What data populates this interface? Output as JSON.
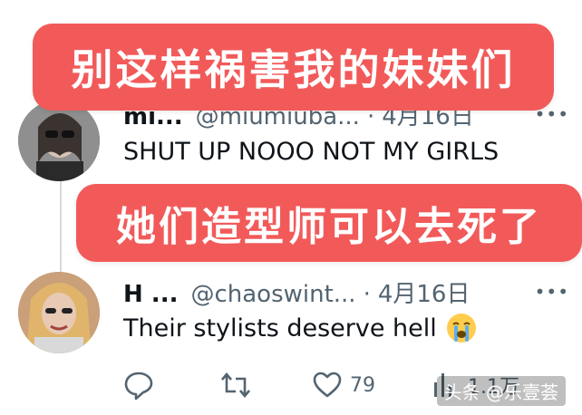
{
  "overlays": {
    "banner_1": "别这样祸害我的妹妹们",
    "banner_2": "她们造型师可以去死了"
  },
  "posts": [
    {
      "name": "mi...",
      "handle": "@miumiuba...",
      "separator": "·",
      "date": "4月16日",
      "more": "•••",
      "text": "SHUT UP NOOO NOT MY GIRLS"
    },
    {
      "name": "H ...",
      "handle": "@chaoswint...",
      "separator": "·",
      "date": "4月16日",
      "more": "•••",
      "text": "Their stylists deserve hell",
      "emoji": "crying-face"
    }
  ],
  "actions": {
    "reply_icon": "reply-icon",
    "repost_icon": "repost-icon",
    "like_icon": "heart-icon",
    "likes_count": "79",
    "views_icon": "bar-chart-icon",
    "views_count": "1.1万"
  },
  "watermark": "头条 @乐壹荟",
  "colors": {
    "banner": "#f25a5a",
    "text": "#0f1419",
    "muted": "#536471"
  }
}
